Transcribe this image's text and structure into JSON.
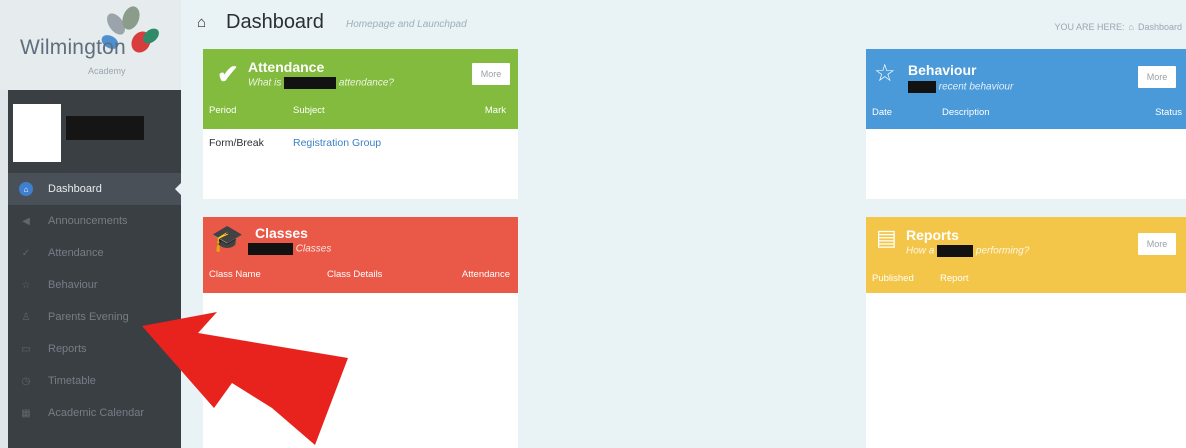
{
  "brand": {
    "name": "Wilmington",
    "subtitle": "Academy"
  },
  "header": {
    "title": "Dashboard",
    "subtitle": "Homepage and Launchpad",
    "breadcrumb_prefix": "YOU ARE HERE:",
    "breadcrumb_current": "Dashboard"
  },
  "sidebar": {
    "items": [
      {
        "label": "Dashboard",
        "icon": "home-icon",
        "active": true
      },
      {
        "label": "Announcements",
        "icon": "megaphone-icon"
      },
      {
        "label": "Attendance",
        "icon": "check-icon"
      },
      {
        "label": "Behaviour",
        "icon": "star-icon"
      },
      {
        "label": "Parents Evening",
        "icon": "people-icon"
      },
      {
        "label": "Reports",
        "icon": "report-icon"
      },
      {
        "label": "Timetable",
        "icon": "clock-icon"
      },
      {
        "label": "Academic Calendar",
        "icon": "calendar-icon"
      }
    ]
  },
  "widgets": {
    "attendance": {
      "title": "Attendance",
      "subtitle_a": "What is",
      "subtitle_b": "attendance?",
      "more": "More",
      "cols": [
        "Period",
        "Subject",
        "Mark"
      ],
      "rows": [
        [
          "Form/Break",
          "Registration Group"
        ]
      ],
      "color": "#82bb3e"
    },
    "behaviour": {
      "title": "Behaviour",
      "subtitle_b": "recent behaviour",
      "more": "More",
      "cols": [
        "Date",
        "Description",
        "Status"
      ],
      "color": "#4a99d8"
    },
    "classes": {
      "title": "Classes",
      "subtitle_b": "Classes",
      "cols": [
        "Class Name",
        "Class Details",
        "Attendance"
      ],
      "color": "#ea5847"
    },
    "reports": {
      "title": "Reports",
      "subtitle_a": "How a",
      "subtitle_b": "performing?",
      "more": "More",
      "cols": [
        "Published",
        "Report"
      ],
      "color": "#f3c64a"
    }
  },
  "colors": {
    "annotation_arrow": "#e8221c",
    "link": "#3b7fc4"
  }
}
